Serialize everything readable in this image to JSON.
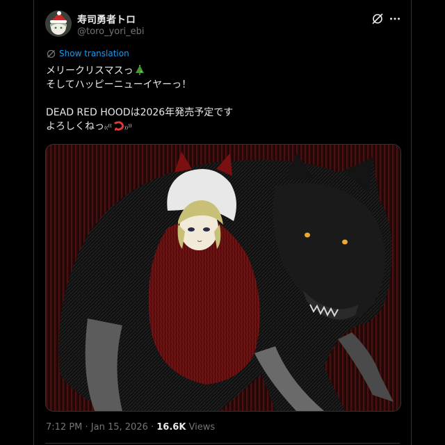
{
  "author": {
    "display_name": "寿司勇者トロ",
    "handle": "@toro_yori_ebi"
  },
  "icons": {
    "avatar": "avatar",
    "grok": "grok-icon",
    "more": "more-icon",
    "translate": "translate-icon",
    "tree_emoji": "christmas-tree-icon",
    "shrimp_emoji": "shrimp-icon"
  },
  "translate_label": "Show translation",
  "tweet": {
    "line1": "メリークリスマスっ",
    "line2": "そしてハッピーニューイヤーっ！",
    "line3": "DEAD RED HOODは2026年発売予定です",
    "line4_text": "よろしくねっ",
    "line4_kaomoji_left": "₍₍⁽⁽",
    "line4_kaomoji_right": "₎₎⁾⁾"
  },
  "meta": {
    "time": "7:12 PM",
    "sep1": " · ",
    "date": "Jan 15, 2026",
    "sep2": " · ",
    "views_count": "16.6K",
    "views_label": " Views"
  },
  "colors": {
    "background": "#000000",
    "text": "#e7e9ea",
    "secondary": "#71767b",
    "link": "#1d9bf0",
    "border": "#2f3336"
  }
}
